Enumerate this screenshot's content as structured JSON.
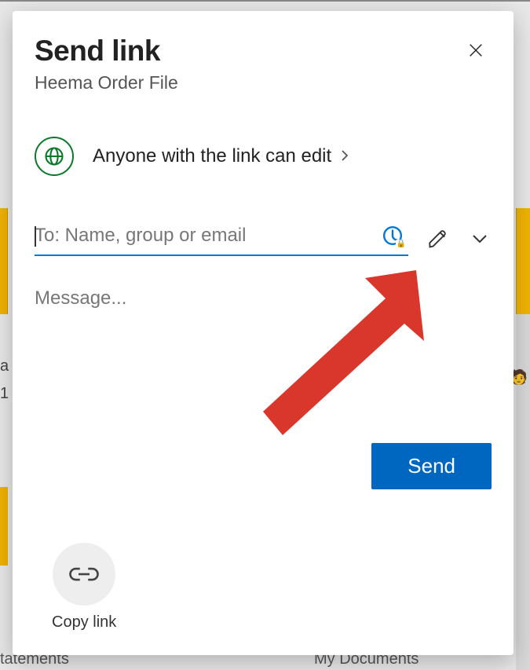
{
  "dialog": {
    "title": "Send link",
    "subtitle": "Heema Order File"
  },
  "linkScope": {
    "label": "Anyone with the link can edit"
  },
  "recipient": {
    "placeholder": "To: Name, group or email",
    "value": ""
  },
  "message": {
    "placeholder": "Message...",
    "value": ""
  },
  "buttons": {
    "send": "Send",
    "copyLink": "Copy link"
  },
  "background": {
    "bottomLeft": "tatements",
    "bottomRight": "My Documents",
    "leftFrag1": "a",
    "leftFrag2": "1"
  }
}
